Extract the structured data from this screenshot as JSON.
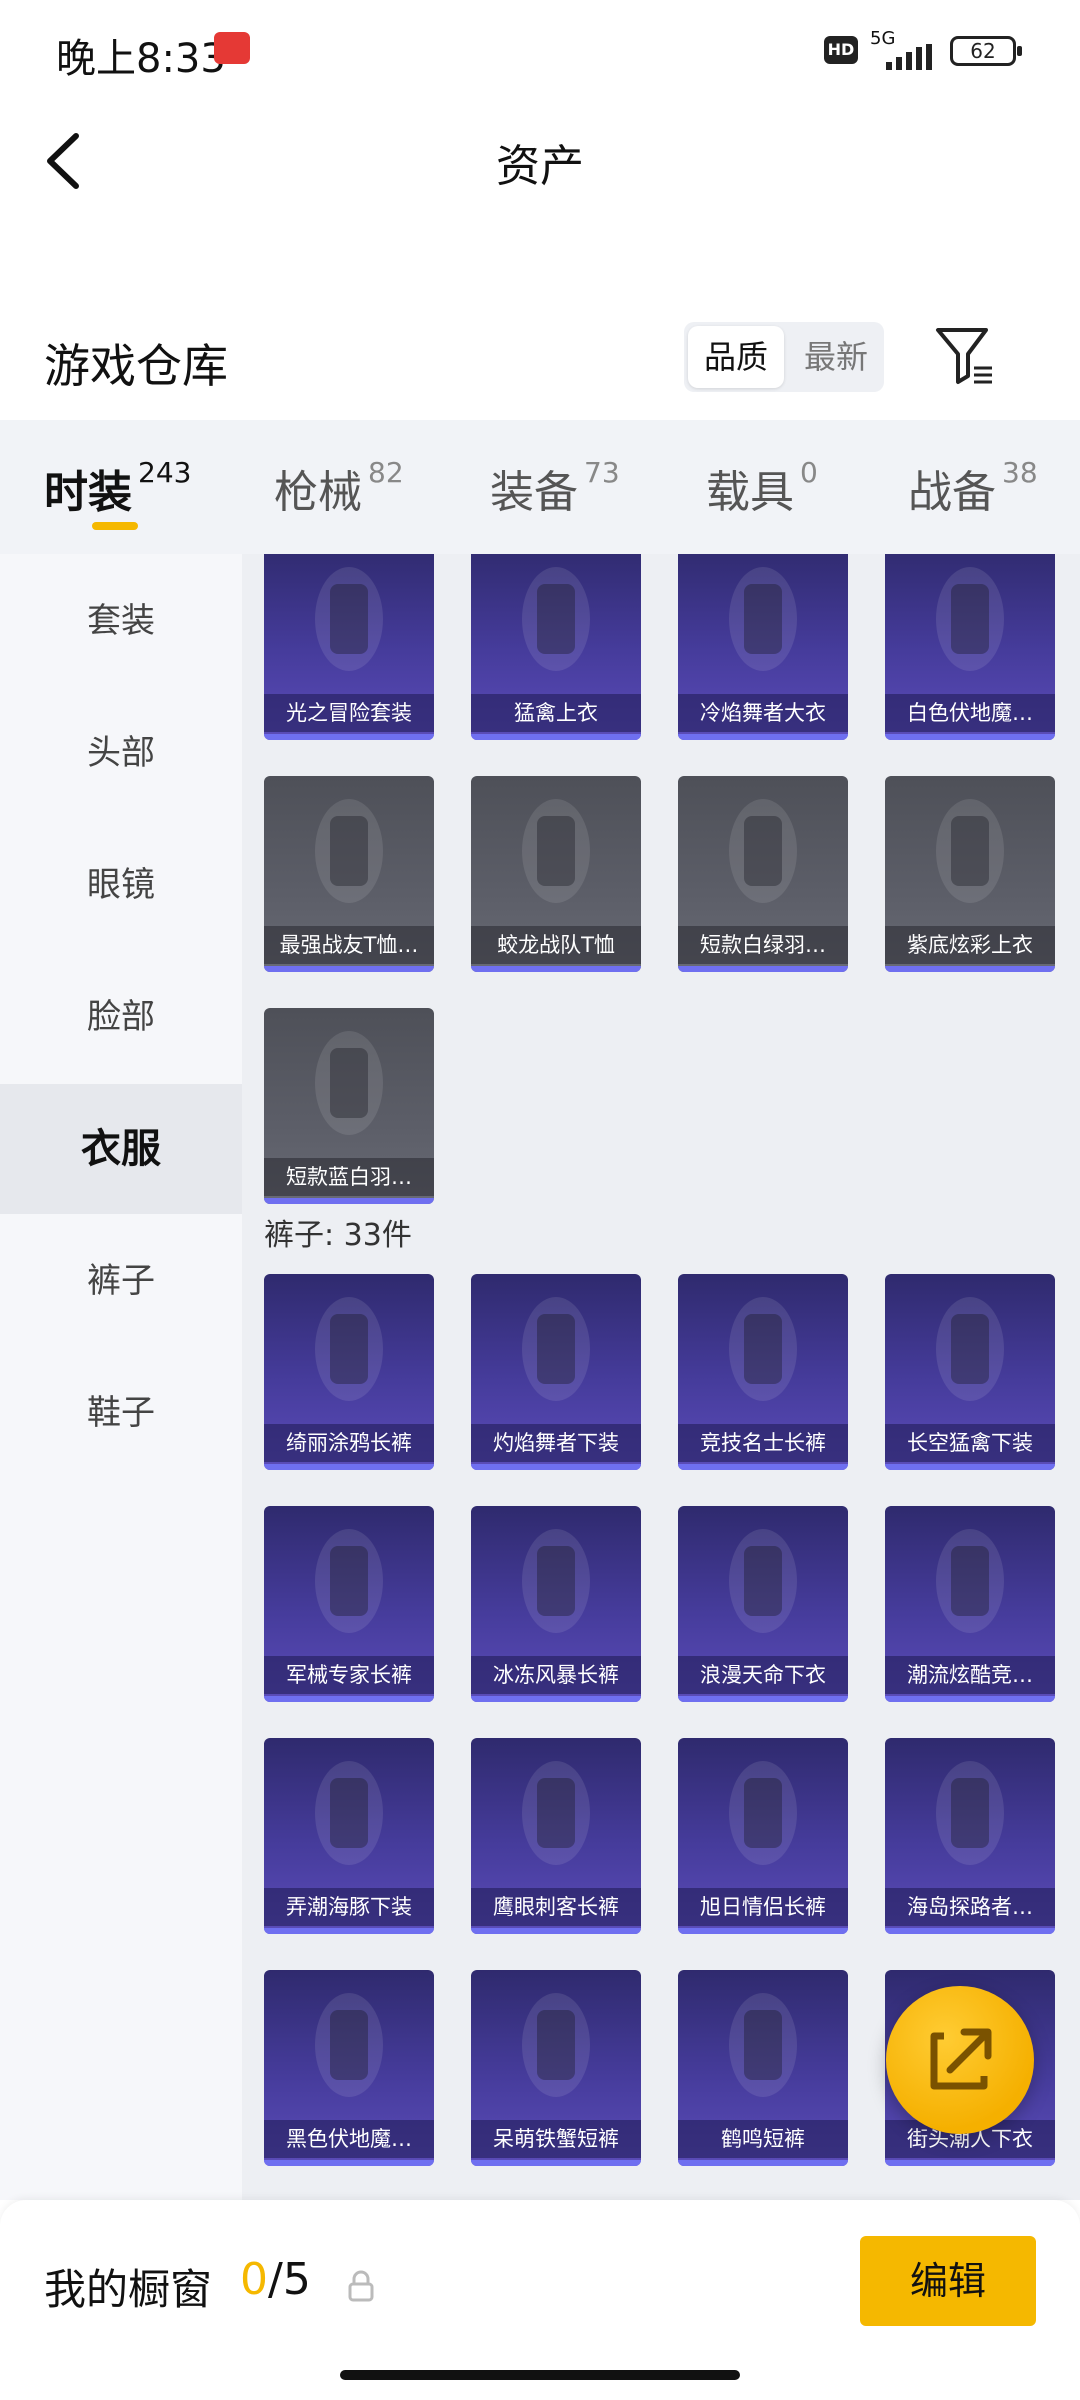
{
  "status_bar": {
    "time": "晚上8:33",
    "network": "5G",
    "battery": "62",
    "hd": "HD"
  },
  "header": {
    "title": "资产"
  },
  "warehouse": {
    "title": "游戏仓库",
    "sort_options": [
      "品质",
      "最新"
    ],
    "active_sort": "品质"
  },
  "tabs": [
    {
      "label": "时装",
      "count": "243"
    },
    {
      "label": "枪械",
      "count": "82"
    },
    {
      "label": "装备",
      "count": "73"
    },
    {
      "label": "载具",
      "count": "0"
    },
    {
      "label": "战备",
      "count": "38"
    }
  ],
  "sidebar": {
    "items": [
      "套装",
      "头部",
      "眼镜",
      "脸部",
      "衣服",
      "裤子",
      "鞋子"
    ],
    "active": "衣服"
  },
  "clothes": {
    "items": [
      {
        "name": "光之冒险套装",
        "style": "purple"
      },
      {
        "name": "猛禽上衣",
        "style": "purple"
      },
      {
        "name": "冷焰舞者大衣",
        "style": "purple"
      },
      {
        "name": "白色伏地魔…",
        "style": "purple"
      },
      {
        "name": "最强战友T恤…",
        "style": "grey"
      },
      {
        "name": "蛟龙战队T恤",
        "style": "grey"
      },
      {
        "name": "短款白绿羽…",
        "style": "grey"
      },
      {
        "name": "紫底炫彩上衣",
        "style": "grey"
      },
      {
        "name": "短款蓝白羽…",
        "style": "grey"
      }
    ]
  },
  "pants": {
    "label": "裤子: 33件",
    "items": [
      {
        "name": "绮丽涂鸦长裤",
        "style": "purple"
      },
      {
        "name": "灼焰舞者下装",
        "style": "purple"
      },
      {
        "name": "竞技名士长裤",
        "style": "purple"
      },
      {
        "name": "长空猛禽下装",
        "style": "purple"
      },
      {
        "name": "军械专家长裤",
        "style": "purple"
      },
      {
        "name": "冰冻风暴长裤",
        "style": "purple"
      },
      {
        "name": "浪漫天命下衣",
        "style": "purple"
      },
      {
        "name": "潮流炫酷竞…",
        "style": "purple"
      },
      {
        "name": "弄潮海豚下装",
        "style": "purple"
      },
      {
        "name": "鹰眼刺客长裤",
        "style": "purple"
      },
      {
        "name": "旭日情侣长裤",
        "style": "purple"
      },
      {
        "name": "海岛探路者…",
        "style": "purple"
      },
      {
        "name": "黑色伏地魔…",
        "style": "purple"
      },
      {
        "name": "呆萌铁蟹短裤",
        "style": "purple"
      },
      {
        "name": "鹤鸣短裤",
        "style": "purple"
      },
      {
        "name": "街头潮人下衣",
        "style": "purple"
      }
    ]
  },
  "bottom": {
    "title": "我的橱窗",
    "current": "0",
    "separator": "/5",
    "edit_label": "编辑"
  },
  "colors": {
    "accent": "#f5b800",
    "card_purple": "#463c9c",
    "card_grey": "#5c5e68",
    "quality_bar": "#6f6ff0"
  }
}
